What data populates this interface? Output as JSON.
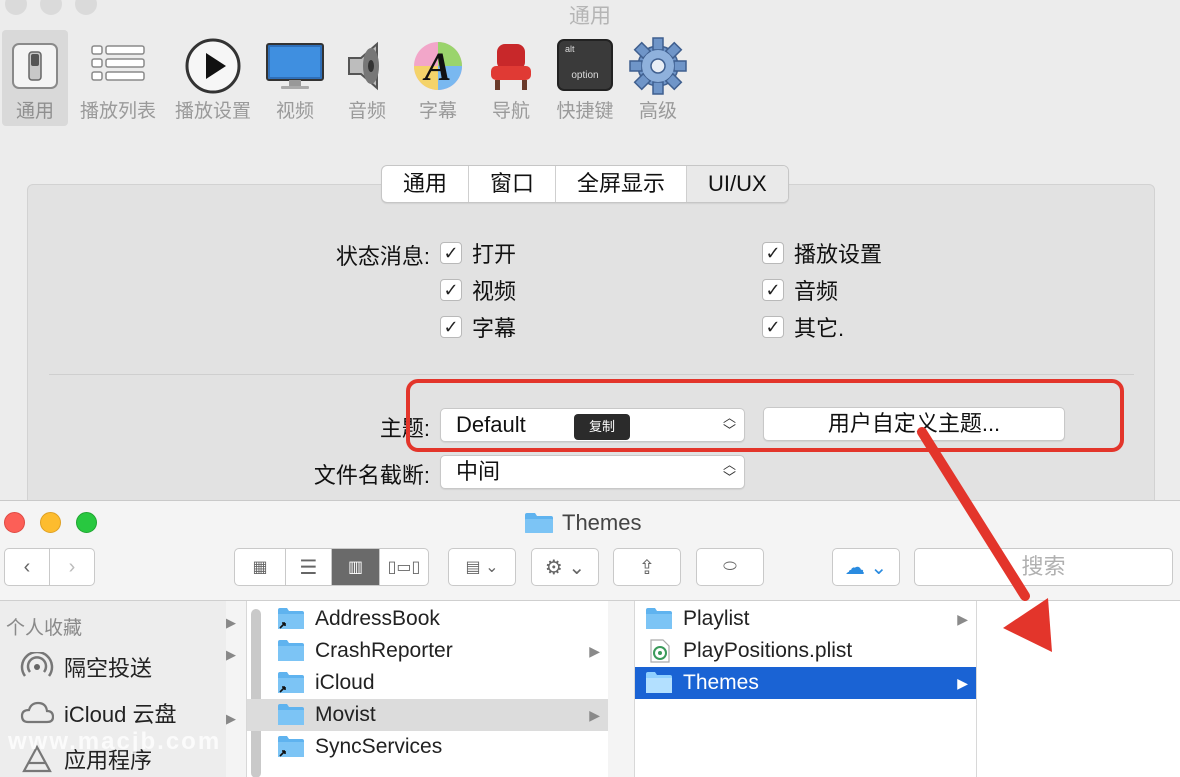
{
  "prefs": {
    "title": "通用",
    "toolbar": [
      {
        "label": "通用",
        "icon": "general-switch-icon"
      },
      {
        "label": "播放列表",
        "icon": "playlist-icon"
      },
      {
        "label": "播放设置",
        "icon": "play-icon"
      },
      {
        "label": "视频",
        "icon": "monitor-icon"
      },
      {
        "label": "音频",
        "icon": "speaker-icon"
      },
      {
        "label": "字幕",
        "icon": "subtitle-icon"
      },
      {
        "label": "导航",
        "icon": "seat-icon"
      },
      {
        "label": "快捷键",
        "icon": "keyboard-key-icon"
      },
      {
        "label": "高级",
        "icon": "gear-icon"
      }
    ],
    "keycap_top": "alt",
    "keycap_bottom": "option",
    "tabs": [
      "通用",
      "窗口",
      "全屏显示",
      "UI/UX"
    ],
    "status_label": "状态消息:",
    "checks_left": [
      "打开",
      "视频",
      "字幕"
    ],
    "checks_right": [
      "播放设置",
      "音频",
      "其它."
    ],
    "check_mark": "✓",
    "theme_label": "主题:",
    "theme_value": "Default",
    "copy_tip": "复制",
    "custom_theme_button": "用户自定义主题...",
    "filename_label": "文件名截断:",
    "filename_value": "中间",
    "highlight_color": "#e3352b"
  },
  "finder": {
    "title": "Themes",
    "search_placeholder": "搜索",
    "sidebar_header": "个人收藏",
    "sidebar_items": [
      "隔空投送",
      "iCloud 云盘",
      "应用程序"
    ],
    "column1": [
      "AddressBook",
      "CrashReporter",
      "iCloud",
      "Movist",
      "SyncServices"
    ],
    "column2": [
      "Playlist",
      "PlayPositions.plist",
      "Themes"
    ],
    "selected_blue": "#1a63d4"
  },
  "watermark": "www.macjb.com"
}
